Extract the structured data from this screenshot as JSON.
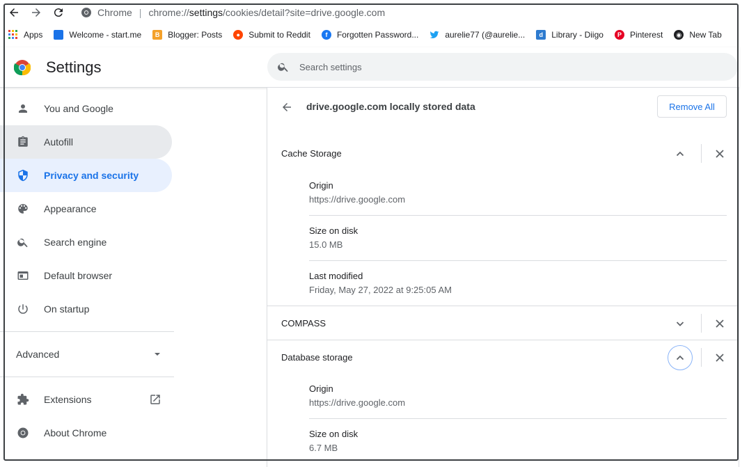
{
  "browser": {
    "site_chip": "Chrome",
    "url_prefix": "chrome://",
    "url_host": "settings",
    "url_path": "/cookies/detail?site=drive.google.com"
  },
  "bookmarks": [
    {
      "label": "Apps",
      "icon": "apps-grid-icon",
      "color": "#ea4335"
    },
    {
      "label": "Welcome - start.me",
      "icon": "startme-icon",
      "color": "#1a73e8"
    },
    {
      "label": "Blogger: Posts",
      "icon": "blogger-icon",
      "color": "#f4a12a"
    },
    {
      "label": "Submit to Reddit",
      "icon": "reddit-icon",
      "color": "#ff4500"
    },
    {
      "label": "Forgotten Password...",
      "icon": "facebook-icon",
      "color": "#1877f2"
    },
    {
      "label": "aurelie77 (@aurelie...",
      "icon": "twitter-icon",
      "color": "#1da1f2"
    },
    {
      "label": "Library - Diigo",
      "icon": "diigo-icon",
      "color": "#2e7bcf"
    },
    {
      "label": "Pinterest",
      "icon": "pinterest-icon",
      "color": "#e60023"
    },
    {
      "label": "New Tab",
      "icon": "globe-icon",
      "color": "#202124"
    }
  ],
  "header": {
    "title": "Settings",
    "search_placeholder": "Search settings"
  },
  "sidebar": {
    "items": [
      {
        "label": "You and Google",
        "icon": "person-icon"
      },
      {
        "label": "Autofill",
        "icon": "clipboard-icon"
      },
      {
        "label": "Privacy and security",
        "icon": "shield-icon"
      },
      {
        "label": "Appearance",
        "icon": "palette-icon"
      },
      {
        "label": "Search engine",
        "icon": "search-icon"
      },
      {
        "label": "Default browser",
        "icon": "browser-window-icon"
      },
      {
        "label": "On startup",
        "icon": "power-icon"
      }
    ],
    "advanced_label": "Advanced",
    "extensions_label": "Extensions",
    "about_label": "About Chrome"
  },
  "main": {
    "title": "drive.google.com locally stored data",
    "remove_all_label": "Remove All",
    "sections": [
      {
        "name": "Cache Storage",
        "expanded": true,
        "details": [
          {
            "label": "Origin",
            "value": "https://drive.google.com"
          },
          {
            "label": "Size on disk",
            "value": "15.0 MB"
          },
          {
            "label": "Last modified",
            "value": "Friday, May 27, 2022 at 9:25:05 AM"
          }
        ]
      },
      {
        "name": "COMPASS",
        "expanded": false
      },
      {
        "name": "Database storage",
        "expanded": true,
        "details": [
          {
            "label": "Origin",
            "value": "https://drive.google.com"
          },
          {
            "label": "Size on disk",
            "value": "6.7 MB"
          }
        ]
      }
    ]
  },
  "colors": {
    "accent": "#1a73e8",
    "active_bg": "#e8f0fe",
    "hover_bg": "#e8eaed",
    "divider": "#dadce0"
  }
}
